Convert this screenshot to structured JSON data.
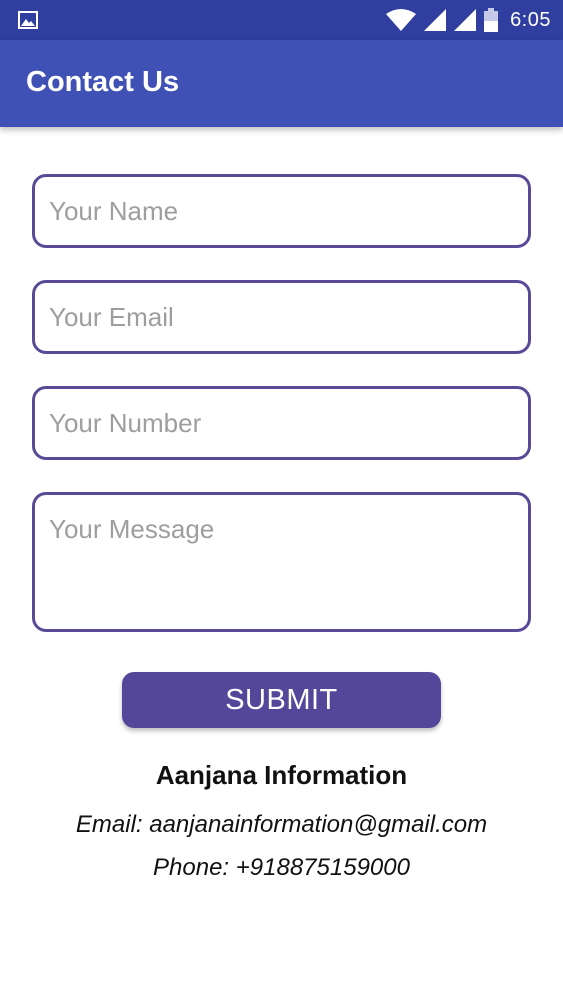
{
  "status_bar": {
    "time": "6:05",
    "icons": [
      "image-notification-icon",
      "wifi-icon",
      "signal-icon",
      "signal-icon",
      "battery-icon"
    ]
  },
  "app_bar": {
    "title": "Contact Us",
    "color": "#3f51b5"
  },
  "form": {
    "name_placeholder": "Your Name",
    "email_placeholder": "Your Email",
    "number_placeholder": "Your Number",
    "message_placeholder": "Your Message",
    "submit_label": "SUBMIT",
    "border_color": "#5a4a96",
    "button_color": "#54479a"
  },
  "info": {
    "company": "Aanjana Information",
    "email_line": "Email: aanjanainformation@gmail.com",
    "phone_line": "Phone: +918875159000"
  }
}
